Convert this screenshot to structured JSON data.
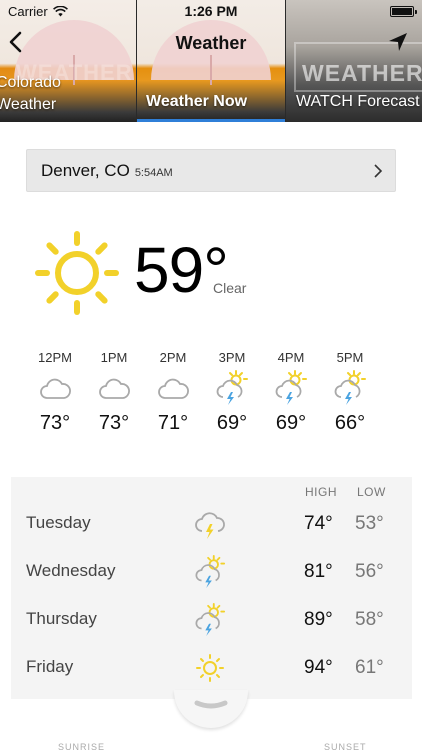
{
  "status_bar": {
    "carrier": "Carrier",
    "time": "1:26 PM"
  },
  "nav": {
    "title": "Weather"
  },
  "tabs": [
    {
      "label_line1": "Colorado",
      "label_line2": "Weather",
      "active": false
    },
    {
      "label": "Weather Now",
      "active": true
    },
    {
      "label": "WATCH Forecast",
      "active": false
    }
  ],
  "tab_backdrop_text": {
    "tile1": "WEATHER",
    "tile3": "WEATHER"
  },
  "location": {
    "name": "Denver, CO",
    "time": "5:54AM"
  },
  "current": {
    "temperature": "59°",
    "condition": "Clear",
    "icon": "sun-icon"
  },
  "hourly": [
    {
      "time": "12PM",
      "icon": "cloud-icon",
      "temp": "73°"
    },
    {
      "time": "1PM",
      "icon": "cloud-icon",
      "temp": "73°"
    },
    {
      "time": "2PM",
      "icon": "cloud-icon",
      "temp": "71°"
    },
    {
      "time": "3PM",
      "icon": "partly-sunny-thunderstorm-icon",
      "temp": "69°"
    },
    {
      "time": "4PM",
      "icon": "partly-sunny-thunderstorm-icon",
      "temp": "69°"
    },
    {
      "time": "5PM",
      "icon": "partly-sunny-thunderstorm-icon",
      "temp": "66°"
    }
  ],
  "daily_headers": {
    "high": "HIGH",
    "low": "LOW"
  },
  "daily": [
    {
      "day": "Tuesday",
      "icon": "thunderstorm-icon",
      "high": "74°",
      "low": "53°"
    },
    {
      "day": "Wednesday",
      "icon": "partly-sunny-thunderstorm-icon",
      "high": "81°",
      "low": "56°"
    },
    {
      "day": "Thursday",
      "icon": "partly-sunny-thunderstorm-icon",
      "high": "89°",
      "low": "58°"
    },
    {
      "day": "Friday",
      "icon": "sun-icon",
      "high": "94°",
      "low": "61°"
    }
  ],
  "footer": {
    "sunrise": "SUNRISE",
    "sunset": "SUNSET"
  },
  "colors": {
    "accent": "#2f7fd8",
    "sun": "#f2d12a",
    "bolt": "#f2d12a",
    "rain_blue": "#4aa3e0",
    "cloud": "#a9a9a9"
  }
}
